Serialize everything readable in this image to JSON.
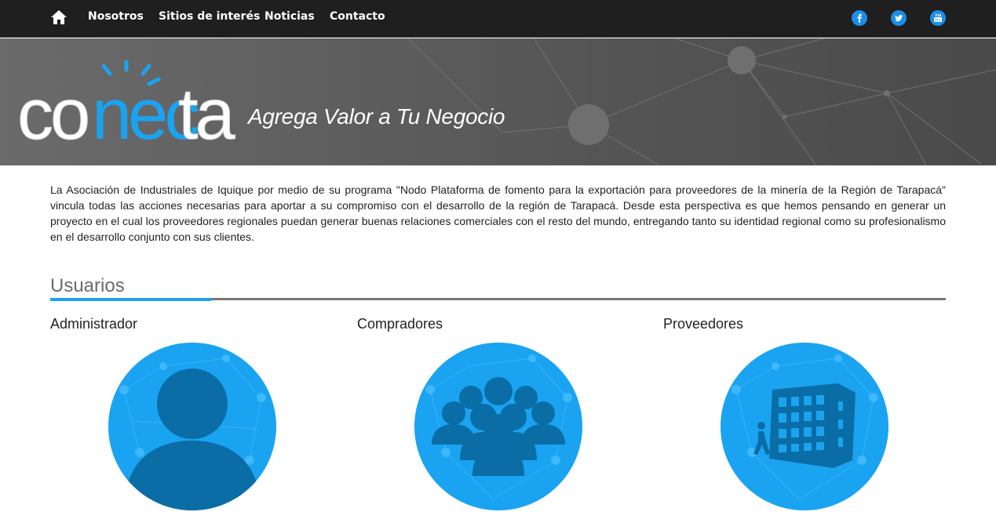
{
  "nav": {
    "home_icon": "home-icon",
    "links": [
      "Nosotros",
      "Sitios de interés",
      "Noticias",
      "Contacto"
    ],
    "social": [
      "facebook-icon",
      "twitter-icon",
      "youtube-icon"
    ]
  },
  "banner": {
    "logo_text": "conecta",
    "tagline": "Agrega Valor a Tu Negocio"
  },
  "intro": "La Asociación de Industriales de Iquique por medio de su programa \"Nodo Plataforma de fomento para la exportación para proveedores de la minería de la Región de Tarapacá\" vincula todas las acciones necesarias para aportar a su compromiso con el desarrollo de la región de Tarapacá. Desde esta perspectiva es que hemos pensando en generar un proyecto en el cual los proveedores regionales puedan generar buenas relaciones comerciales con el resto del mundo, entregando tanto su identidad regional como su profesionalismo en el desarrollo conjunto con sus clientes.",
  "section": {
    "title": "Usuarios"
  },
  "users": [
    {
      "title": "Administrador",
      "icon": "person-icon"
    },
    {
      "title": "Compradores",
      "icon": "group-icon"
    },
    {
      "title": "Proveedores",
      "icon": "building-icon"
    }
  ],
  "colors": {
    "accent": "#1aa3f0",
    "nav_bg": "#1f1f1f",
    "icon_dark": "#0b6da6"
  }
}
